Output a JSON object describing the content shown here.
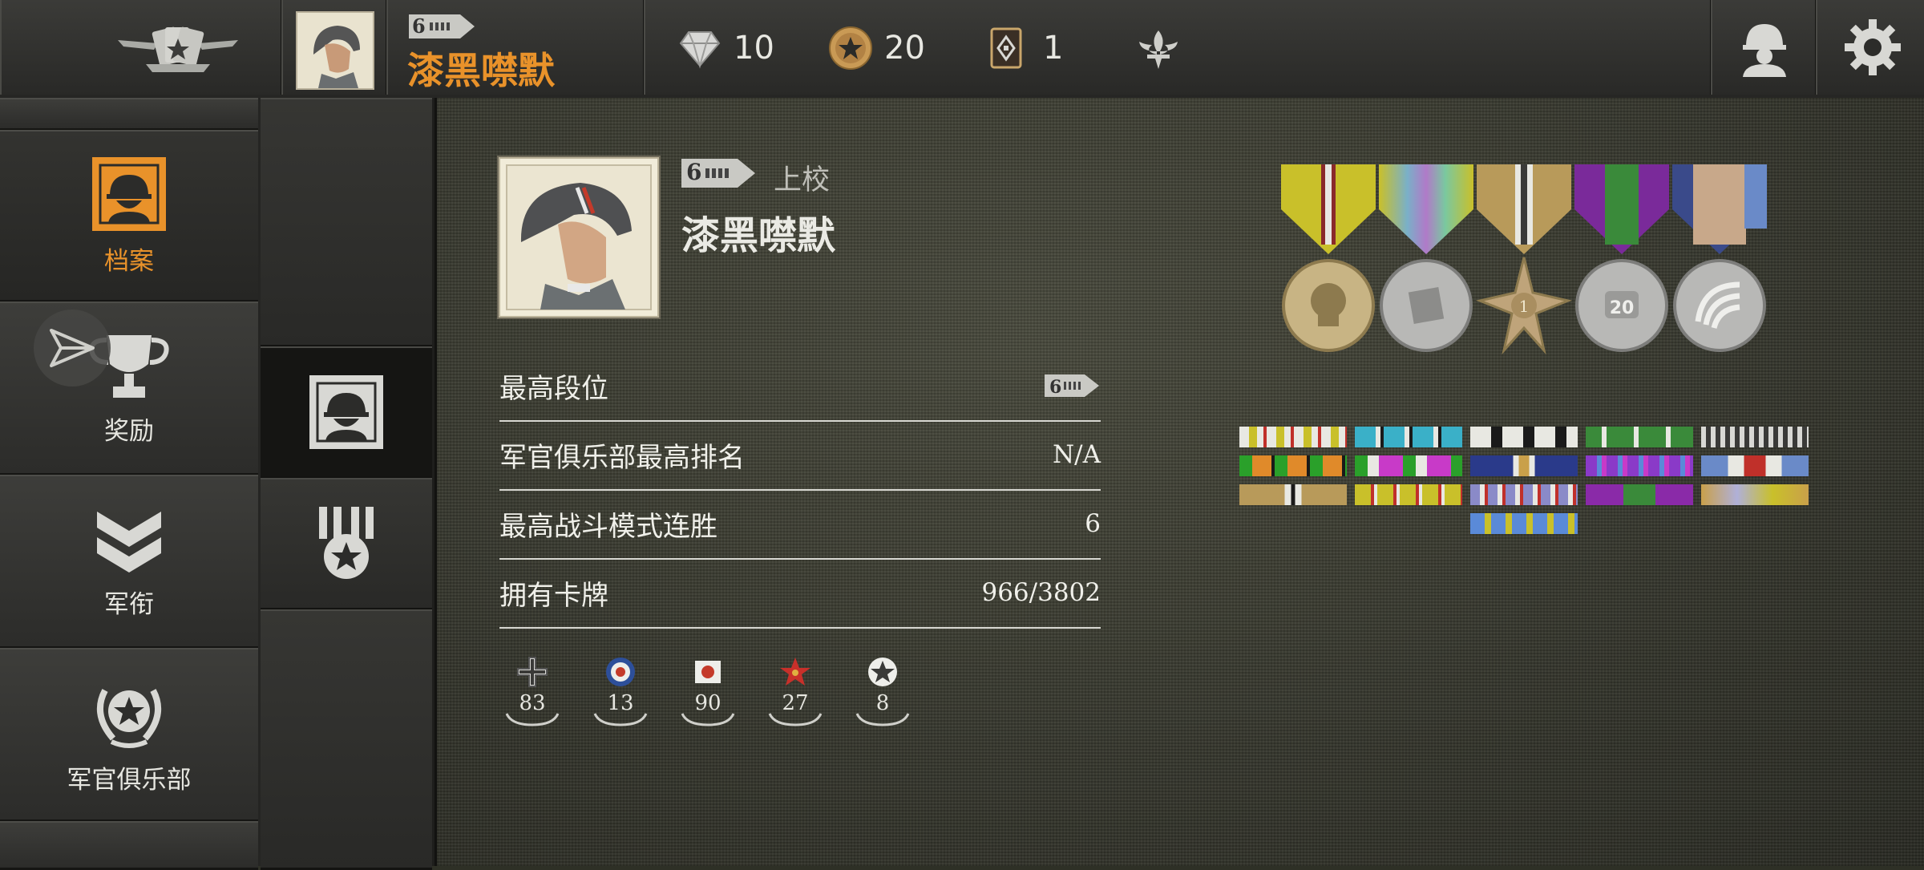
{
  "topbar": {
    "player_name": "漆黑噤默",
    "rank_number": "6",
    "diamonds": "10",
    "gold": "20",
    "cards": "1"
  },
  "sidenav": [
    {
      "label": "档案",
      "active": true
    },
    {
      "label": "奖励",
      "active": false
    },
    {
      "label": "军衔",
      "active": false
    },
    {
      "label": "军官俱乐部",
      "active": false
    }
  ],
  "profile": {
    "rank_number": "6",
    "rank_title": "上校",
    "name": "漆黑噤默"
  },
  "stats": [
    {
      "label": "最高段位",
      "value": "rank-6-badge"
    },
    {
      "label": "军官俱乐部最高排名",
      "value": "N/A"
    },
    {
      "label": "最高战斗模式连胜",
      "value": "6"
    },
    {
      "label": "拥有卡牌",
      "value": "966/3802"
    }
  ],
  "nations": [
    {
      "icon": "germany-cross-icon",
      "count": "83"
    },
    {
      "icon": "britain-roundel-icon",
      "count": "13"
    },
    {
      "icon": "japan-flag-icon",
      "count": "90"
    },
    {
      "icon": "soviet-star-icon",
      "count": "27"
    },
    {
      "icon": "usa-star-icon",
      "count": "8"
    }
  ],
  "medals": [
    {
      "icon": "skull-medal-icon"
    },
    {
      "icon": "card-medal-icon"
    },
    {
      "icon": "star-1-medal-icon",
      "text": "1"
    },
    {
      "icon": "20-medal-icon",
      "text": "20"
    },
    {
      "icon": "wing-medal-icon"
    }
  ],
  "colors": {
    "accent": "#e9922a",
    "text": "#f0f0ea"
  }
}
